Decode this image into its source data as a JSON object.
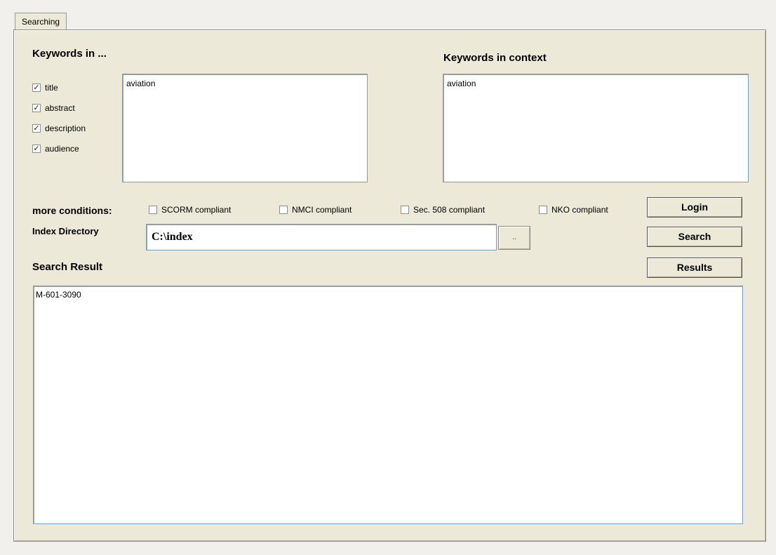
{
  "tab": {
    "label": "Searching"
  },
  "left_section": {
    "heading": "Keywords in ...",
    "checkboxes": [
      {
        "label": "title",
        "checked": true
      },
      {
        "label": "abstract",
        "checked": true
      },
      {
        "label": "description",
        "checked": true
      },
      {
        "label": "audience",
        "checked": true
      }
    ],
    "keywords_value": "aviation"
  },
  "right_section": {
    "heading": "Keywords in context",
    "context_value": "aviation"
  },
  "conditions": {
    "label": "more conditions:",
    "options": [
      {
        "label": "SCORM compliant",
        "checked": false
      },
      {
        "label": "NMCI compliant",
        "checked": false
      },
      {
        "label": "Sec. 508 compliant",
        "checked": false
      },
      {
        "label": "NKO compliant",
        "checked": false
      }
    ]
  },
  "index_directory": {
    "label": "Index Directory",
    "value": "C:\\index",
    "browse_label": ".."
  },
  "buttons": {
    "login": "Login",
    "search": "Search",
    "results": "Results"
  },
  "search_result": {
    "heading": "Search Result",
    "items": [
      "M-601-3090"
    ]
  }
}
